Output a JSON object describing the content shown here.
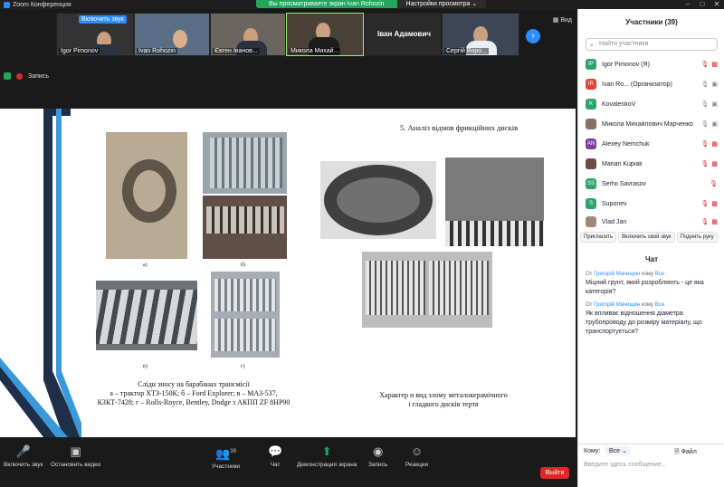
{
  "window": {
    "title": "Zoom Конференция"
  },
  "banner": {
    "viewing": "Вы просматриваете экран Ivan Rohozin",
    "view_options": "Настройки просмотра ⌄"
  },
  "video": {
    "unmute_prompt": "Включить звук",
    "tiles": [
      "Igor Pimonov",
      "Ivan Rohozin",
      "Євген Іванов...",
      "Микола Михай...",
      "Іван Адамович",
      "Сергій Воро..."
    ],
    "view_label": "Вид",
    "record_label": "Запись"
  },
  "slide": {
    "title": "5. Аналіз відмов фрикційних дисків",
    "labels": [
      "а)",
      "б)",
      "в)",
      "г)"
    ],
    "left_caption": [
      "Сліди зносу на барабанах трансмісії",
      "а – трактор ХТЗ-150К; б – Ford Explorer; в – МАЗ-537,",
      "КЗКТ-7428; г – Rolls-Royce, Bentley, Dodge з АКПП ZF 8HP90"
    ],
    "right_caption": [
      "Характер и вид злому металокерамічного",
      "і гладкого дисків тертя"
    ]
  },
  "participants": {
    "header": "Участники (39)",
    "search_placeholder": "Найти участника",
    "list": [
      {
        "initials": "IP",
        "name": "Igor Pimonov (Я)",
        "color": "#2ea36b"
      },
      {
        "initials": "IR",
        "name": "Ivan Ro... (Организатор)",
        "color": "#e0413a"
      },
      {
        "initials": "K",
        "name": "KovalenkoV",
        "color": "#2ea36b"
      },
      {
        "initials": "",
        "name": "Микола Михайлович Марченко",
        "color": "#8d6e63"
      },
      {
        "initials": "AN",
        "name": "Alexey Nemchuk",
        "color": "#7b3fa0"
      },
      {
        "initials": "",
        "name": "Marian Kupiak",
        "color": "#6d4c41"
      },
      {
        "initials": "SS",
        "name": "Serhii Savrasov",
        "color": "#2ea36b"
      },
      {
        "initials": "S",
        "name": "Suponev",
        "color": "#2ea36b"
      },
      {
        "initials": "",
        "name": "Vlad Jan",
        "color": "#a1887f"
      }
    ],
    "buttons": [
      "Пригласить",
      "Включить свой звук",
      "Поднять руку"
    ]
  },
  "chat": {
    "header": "Чат",
    "messages": [
      {
        "from": "Григорій Мачищин",
        "to": "Все",
        "text": "Міцний грунт, який розробляють - це яка категорія?"
      },
      {
        "from": "Григорій Мачищин",
        "to": "Все",
        "text": "Як впливає відношення діаметра трубопроводу до розміру матеріалу, що транспортується?"
      }
    ],
    "meta_prefix": "От",
    "meta_mid": "кому",
    "to_label": "Кому:",
    "to_value": "Все",
    "file_label": "Файл",
    "input_placeholder": "Введите здесь сообщение..."
  },
  "toolbar": {
    "unmute": "Включить звук",
    "stop_video": "Остановить видео",
    "participants": "Участники",
    "participants_count": "39",
    "chat": "Чат",
    "share": "Демонстрация экрана",
    "record": "Запись",
    "reactions": "Реакции",
    "leave": "Выйти"
  },
  "colors": {
    "accent": "#2d8cff",
    "share_green": "#23a55a",
    "leave_red": "#e02828"
  }
}
